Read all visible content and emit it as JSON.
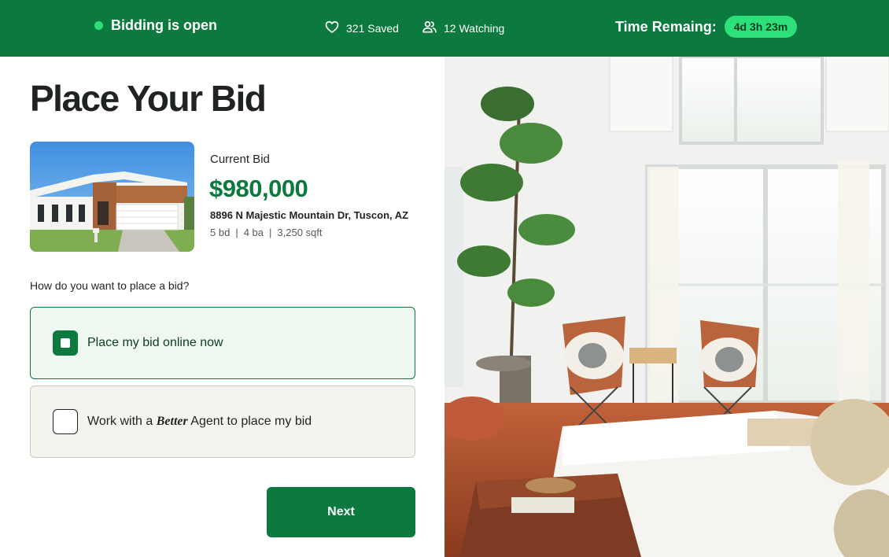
{
  "header": {
    "status_label": "Bidding is open",
    "saved_label": "321 Saved",
    "watching_label": "12 Watching",
    "time_label": "Time Remaing:",
    "time_value": "4d 3h 23m"
  },
  "page": {
    "title": "Place Your Bid"
  },
  "property": {
    "bid_label": "Current Bid",
    "bid_amount": "$980,000",
    "address": "8896 N Majestic Mountain Dr, Tuscon, AZ",
    "beds": "5 bd",
    "baths": "4 ba",
    "sqft": "3,250 sqft",
    "separator": "|"
  },
  "form": {
    "question": "How do you want to place a bid?",
    "option_online": "Place my bid online now",
    "option_agent_prefix": "Work with a",
    "option_agent_brand": "Better",
    "option_agent_suffix": "Agent to place my bid",
    "next_label": "Next"
  },
  "icons": {
    "status": "status-dot-icon",
    "saved": "heart-icon",
    "watching": "users-icon"
  },
  "colors": {
    "brand_green": "#0c7a3e",
    "accent_green": "#2ee07a",
    "selected_bg": "#eef7f0",
    "unselected_bg": "#f4f4ee"
  }
}
